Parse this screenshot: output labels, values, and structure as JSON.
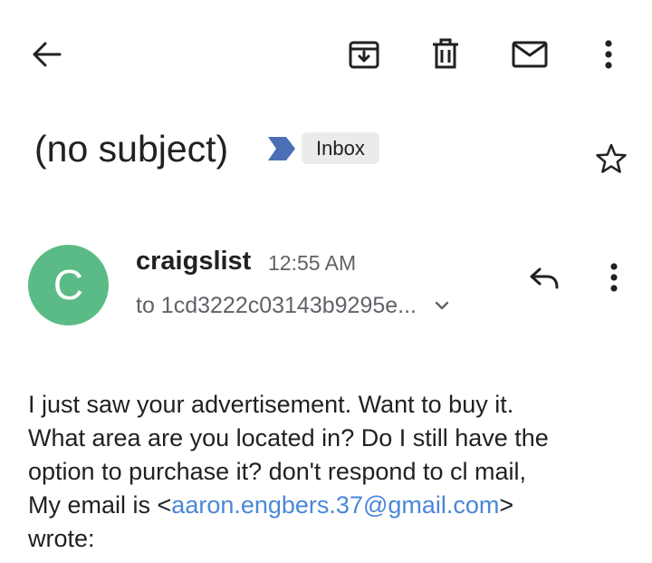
{
  "toolbar": {
    "back_icon": "arrow-back-icon",
    "archive_icon": "archive-icon",
    "delete_icon": "trash-icon",
    "mark_unread_icon": "mail-icon",
    "more_icon": "more-vertical-icon"
  },
  "thread": {
    "subject": "(no subject)",
    "importance_icon": "importance-marker-icon",
    "label": "Inbox",
    "star_icon": "star-outline-icon"
  },
  "message": {
    "avatar_letter": "C",
    "avatar_color": "#5bbb86",
    "sender": "craigslist",
    "time": "12:55 AM",
    "recipient": "to 1cd3222c03143b9295e...",
    "details_icon": "chevron-down-icon",
    "reply_icon": "reply-icon",
    "more_icon": "more-vertical-icon",
    "body": {
      "line1": "I just saw your advertisement. Want to buy it.",
      "line2": "What area are you located in?  Do I still have the",
      "line3": "option to purchase it? don't respond to cl mail,",
      "line4_prefix": "My email is  <",
      "email": "aaron.engbers.37@gmail.com",
      "line4_suffix": ">",
      "line5": "wrote:"
    }
  },
  "colors": {
    "link": "#4a87d8",
    "importance": "#4a6fb5",
    "chip_bg": "#ebebeb"
  }
}
